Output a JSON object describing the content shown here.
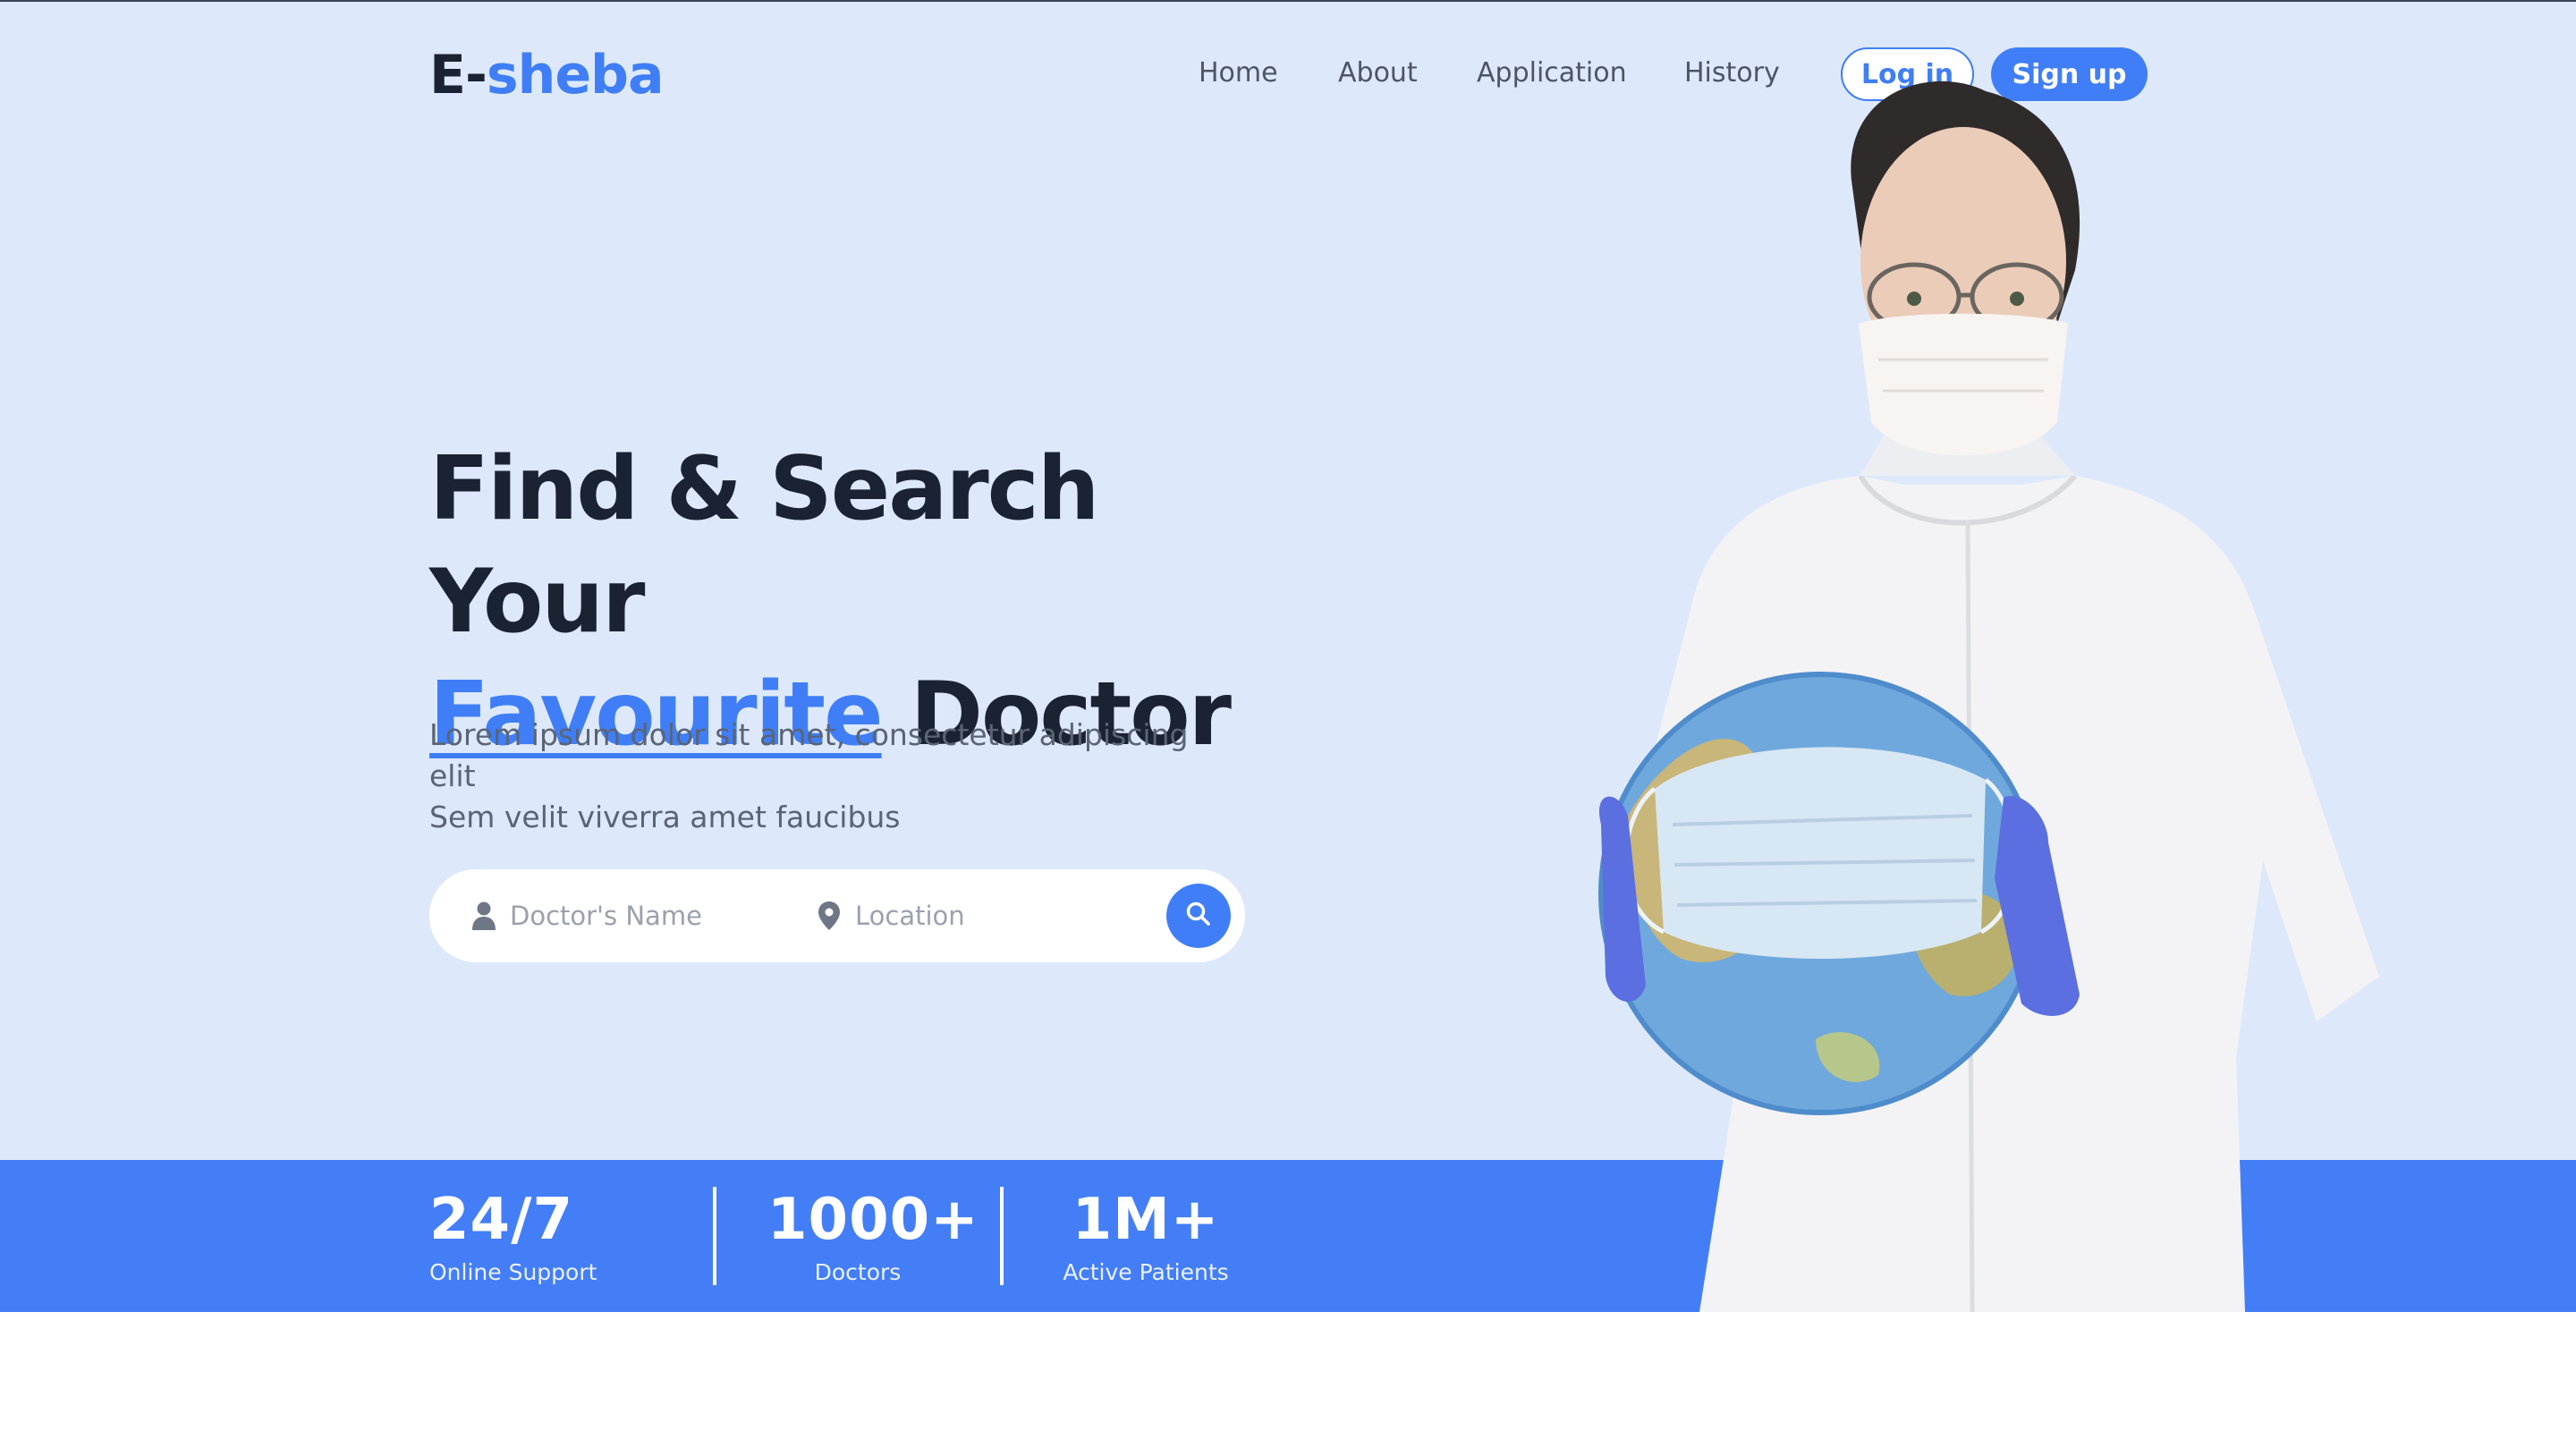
{
  "brand": {
    "logo_part1": "E-",
    "logo_part2": "sheba",
    "accent_color": "#3f7ef6"
  },
  "nav": {
    "items": [
      "Home",
      "About",
      "Application",
      "History"
    ],
    "login_label": "Log in",
    "signup_label": "Sign up"
  },
  "hero": {
    "headline_line1": "Find & Search Your",
    "headline_highlight": "Favourite",
    "headline_line2_rest": "Doctor",
    "subtext_line1": "Lorem ipsum dolor sit amet, consectetur adipiscing elit",
    "subtext_line2": "Sem velit viverra amet faucibus",
    "background_color": "#dde9fb"
  },
  "search": {
    "doctor_placeholder": "Doctor's Name",
    "location_placeholder": "Location",
    "doctor_icon": "user-icon",
    "location_icon": "map-pin-icon",
    "button_icon": "search-icon"
  },
  "stats": [
    {
      "value": "24/7",
      "label": "Online Support"
    },
    {
      "value": "1000+",
      "label": "Doctors"
    },
    {
      "value": "1M+",
      "label": "Active Patients"
    }
  ],
  "statbar_color": "#437ef7"
}
